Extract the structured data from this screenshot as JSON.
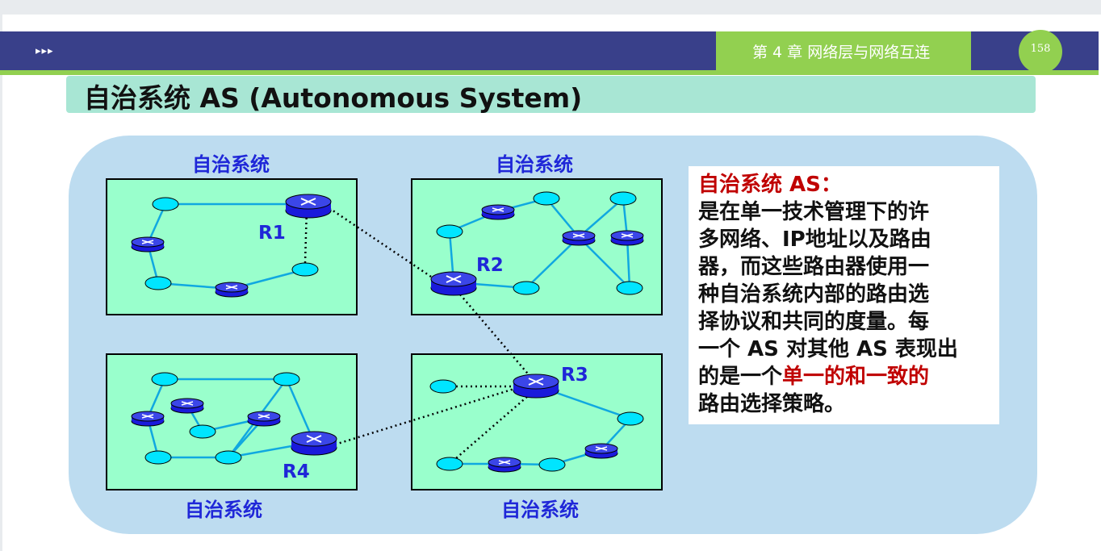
{
  "header": {
    "arrows": "▸▸▸",
    "chapter": "第 4 章  网络层与网络互连",
    "page_number": "158"
  },
  "slide": {
    "title": "自治系统 AS (Autonomous System)"
  },
  "diagram": {
    "as_labels": [
      "自治系统",
      "自治系统",
      "自治系统",
      "自治系统"
    ],
    "routers": [
      "R1",
      "R2",
      "R3",
      "R4"
    ]
  },
  "textbox": {
    "heading": "自治系统 AS：",
    "lines": [
      "是在单一技术管理下的许",
      "多网络、IP地址以及路由",
      "器，而这些路由器使用一",
      "种自治系统内部的路由选",
      "择协议和共同的度量。每",
      "一个 AS 对其他 AS 表现出"
    ],
    "line7_prefix": "的是一个",
    "line7_highlight": "单一的和一致的",
    "line8": "路由选择策略。"
  },
  "colors": {
    "header_bar": "#39408a",
    "accent_green": "#92d050",
    "title_band": "#a8e6d4",
    "diagram_bg": "#bddcf0",
    "as_box": "#99ffcc",
    "node_cyan": "#00e5ff",
    "router_blue": "#1a1adb",
    "label_blue": "#1f27d8",
    "highlight_red": "#c00000"
  }
}
